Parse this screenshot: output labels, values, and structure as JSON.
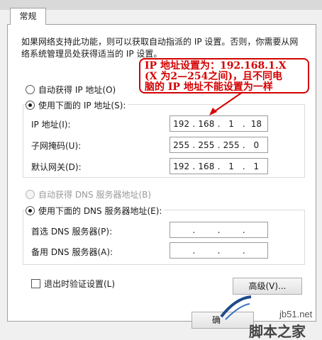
{
  "tab": {
    "label": "常规"
  },
  "description": "如果网络支持此功能，则可以获取自动指派的 IP 设置。否则，你需要从网络系统管理员处获得适当的 IP 设置。",
  "ip_section": {
    "auto_option": "自动获得 IP 地址(O)",
    "manual_option": "使用下面的 IP 地址(S):",
    "selected": "manual",
    "fields": [
      {
        "label": "IP 地址(I):",
        "octets": [
          "192",
          "168",
          "1",
          "18"
        ]
      },
      {
        "label": "子网掩码(U):",
        "octets": [
          "255",
          "255",
          "255",
          "0"
        ]
      },
      {
        "label": "默认网关(D):",
        "octets": [
          "192",
          "168",
          "1",
          "1"
        ]
      }
    ]
  },
  "dns_section": {
    "auto_option": "自动获得 DNS 服务器地址(B)",
    "manual_option": "使用下面的 DNS 服务器地址(E):",
    "selected": "manual",
    "fields": [
      {
        "label": "首选 DNS 服务器(P):",
        "octets": [
          "",
          "",
          "",
          ""
        ]
      },
      {
        "label": "备用 DNS 服务器(A):",
        "octets": [
          "",
          "",
          "",
          ""
        ]
      }
    ]
  },
  "validate_checkbox": {
    "label": "退出时验证设置(L)",
    "checked": false
  },
  "advanced_button": "高级(V)...",
  "ok_button": "确",
  "annotation": {
    "line1": "IP 地址设置为：192.168.1.X",
    "line2": "(X 为2—254之间)，且不同电",
    "line3": "脑的 IP 地址不能设置为一样",
    "color": "#d40000"
  },
  "watermark": {
    "site": "jb51.net",
    "name": "脚本之家"
  }
}
